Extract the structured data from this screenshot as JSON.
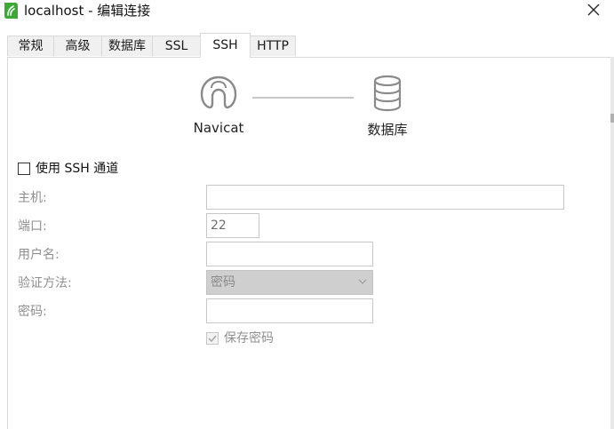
{
  "window": {
    "title": "localhost - 编辑连接"
  },
  "tabs": [
    {
      "label": "常规",
      "active": false
    },
    {
      "label": "高级",
      "active": false
    },
    {
      "label": "数据库",
      "active": false
    },
    {
      "label": "SSL",
      "active": false
    },
    {
      "label": "SSH",
      "active": true
    },
    {
      "label": "HTTP",
      "active": false
    }
  ],
  "diagram": {
    "left_label": "Navicat",
    "right_label": "数据库",
    "left_icon": "navicat-logo-icon",
    "right_icon": "database-icon"
  },
  "ssh": {
    "use_ssh_label": "使用 SSH 通道",
    "use_ssh_checked": false,
    "host_label": "主机:",
    "host_value": "",
    "port_label": "端口:",
    "port_value": "22",
    "user_label": "用户名:",
    "user_value": "",
    "auth_label": "验证方法:",
    "auth_value": "密码",
    "password_label": "密码:",
    "password_value": "",
    "save_password_label": "保存密码",
    "save_password_checked": true
  },
  "colors": {
    "accent_green": "#3aaa35",
    "disabled_text": "#8f8f8f",
    "border": "#c7c7c7",
    "select_bg": "#cfcfcf"
  }
}
